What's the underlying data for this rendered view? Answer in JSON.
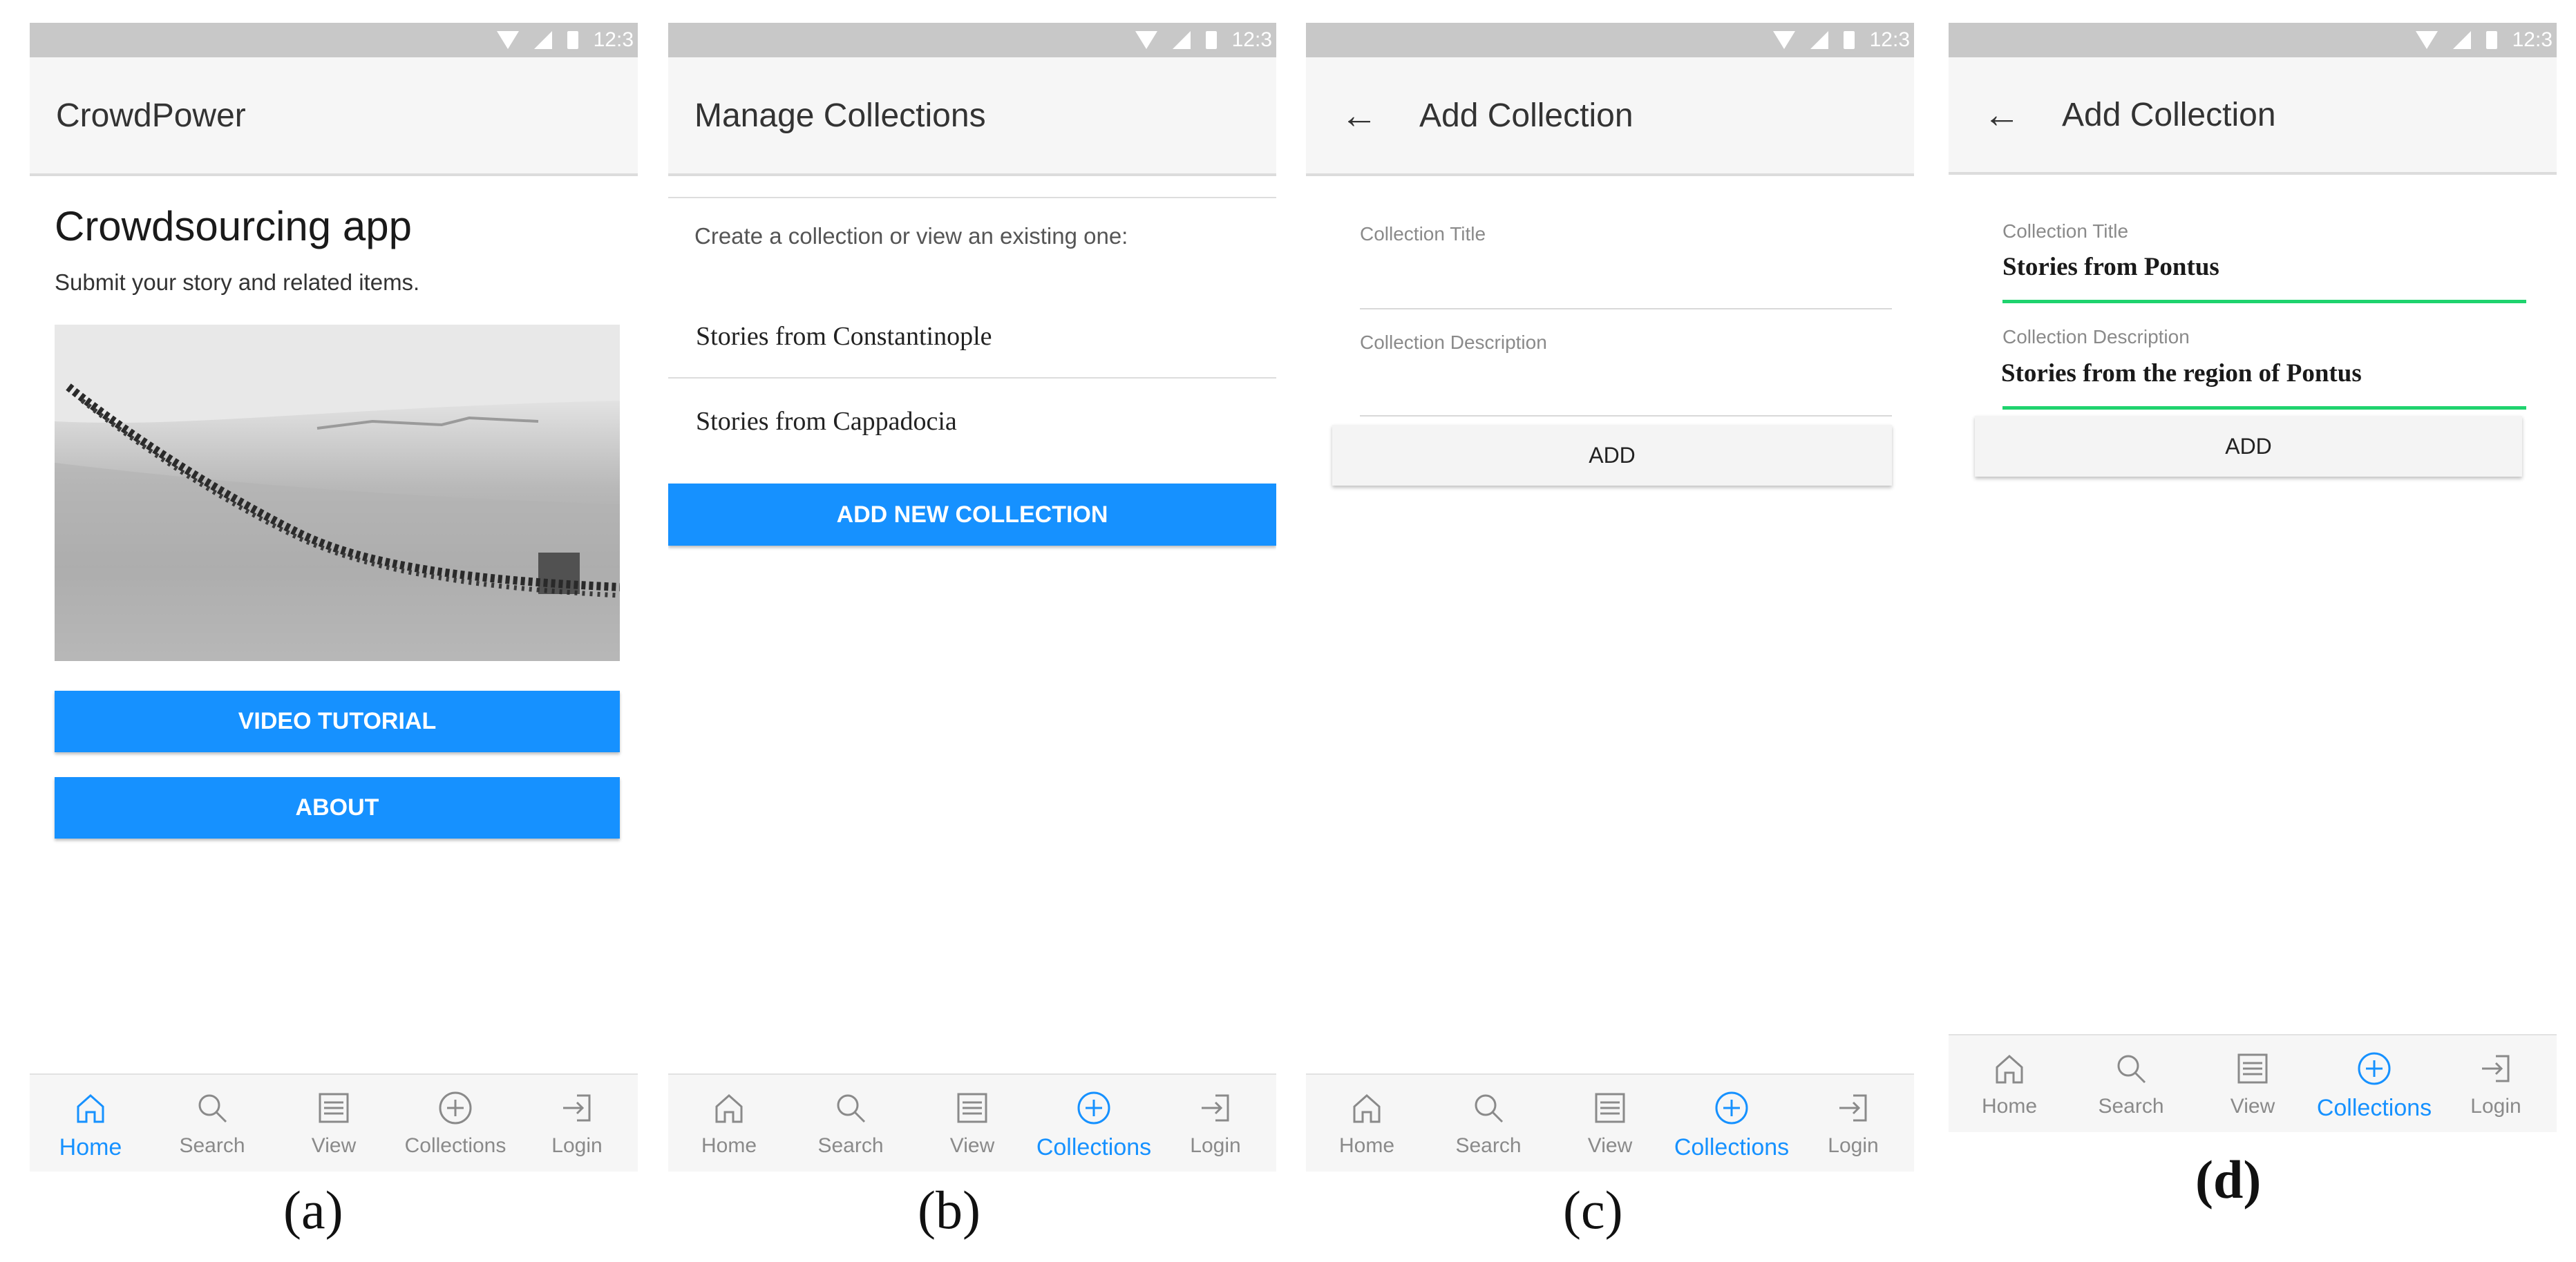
{
  "status_time": "12:3",
  "nav": {
    "home": "Home",
    "search": "Search",
    "view": "View",
    "collections": "Collections",
    "login": "Login"
  },
  "colors": {
    "accent": "#1691ff",
    "active_field": "#1fd36e",
    "appbar": "#f6f6f6",
    "statusbar": "#c8c8c8"
  },
  "screen_a": {
    "app_title": "CrowdPower",
    "heading": "Crowdsourcing app",
    "subtitle": "Submit your story and related items.",
    "video_button": "VIDEO TUTORIAL",
    "about_button": "ABOUT",
    "active_tab": "Home"
  },
  "screen_b": {
    "title": "Manage Collections",
    "intro": "Create a collection or view an existing one:",
    "collections": [
      "Stories from Constantinople",
      "Stories from Cappadocia"
    ],
    "add_button": "ADD NEW COLLECTION",
    "active_tab": "Collections"
  },
  "screen_c": {
    "title": "Add Collection",
    "title_label": "Collection Title",
    "description_label": "Collection Description",
    "title_value": "",
    "description_value": "",
    "add_button": "ADD",
    "active_tab": "Collections"
  },
  "screen_d": {
    "title": "Add Collection",
    "title_label": "Collection Title",
    "description_label": "Collection Description",
    "title_value": "Stories from Pontus",
    "description_value": "Stories from the region of Pontus",
    "add_button": "ADD",
    "active_tab": "Collections"
  },
  "captions": [
    "(a)",
    "(b)",
    "(c)",
    "(d)"
  ]
}
